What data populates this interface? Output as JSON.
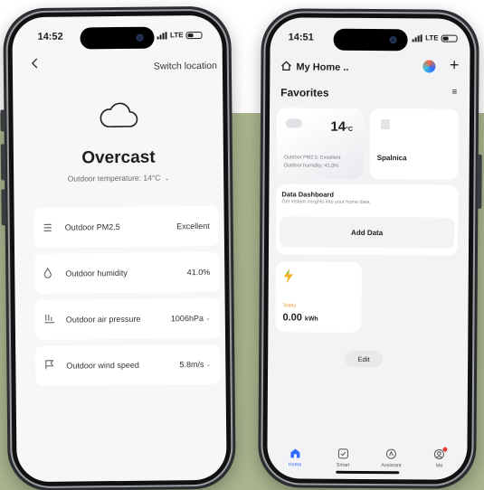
{
  "left_phone": {
    "status": {
      "time": "14:52",
      "network": "LTE"
    },
    "header": {
      "back_icon": "chevron-left-icon",
      "switch_location_label": "Switch location"
    },
    "weather": {
      "icon": "cloud-icon",
      "condition": "Overcast",
      "outdoor_temperature_label": "Outdoor temperature: 14°C",
      "temperature_chevron": "⌄"
    },
    "metrics": [
      {
        "icon": "pm25-icon",
        "glyph": "☰",
        "label": "Outdoor PM2.5",
        "value": "Excellent",
        "has_chevron": false
      },
      {
        "icon": "droplet-icon",
        "glyph": "◇",
        "label": "Outdoor humidity",
        "value": "41.0%",
        "has_chevron": false
      },
      {
        "icon": "pressure-icon",
        "glyph": "⫫",
        "label": "Outdoor air pressure",
        "value": "1006hPa",
        "has_chevron": true
      },
      {
        "icon": "wind-flag-icon",
        "glyph": "⚐",
        "label": "Outdoor wind speed",
        "value": "5.8m/s",
        "has_chevron": true
      }
    ],
    "chevron": "⌄"
  },
  "right_phone": {
    "status": {
      "time": "14:51",
      "network": "LTE"
    },
    "header": {
      "home_label": "My Home ..",
      "home_icon": "house-icon",
      "assistant_logo": "ai-assistant-logo-icon",
      "add_icon": "+"
    },
    "favorites": {
      "title": "Favorites",
      "list_icon": "≡"
    },
    "weather_card": {
      "temperature": "14",
      "unit": "°C",
      "pm25_line": "Outdoor PM2.5: Excellent",
      "humidity_line": "Outdoor humidity: 41.0%"
    },
    "device_card": {
      "name": "Spalnica",
      "icon": "speaker-icon"
    },
    "data_dashboard": {
      "title": "Data Dashboard",
      "subtitle": "Get instant insights into your home data.",
      "add_label": "Add Data"
    },
    "energy_card": {
      "icon": "lightning-icon",
      "period": "Today",
      "value": "0.00",
      "unit": "kWh"
    },
    "edit_label": "Edit",
    "tabs": [
      {
        "label": "Home",
        "icon": "home-tab-icon",
        "glyph": "⌂",
        "active": true,
        "badge": false
      },
      {
        "label": "Smart",
        "icon": "smart-checkbox-icon",
        "glyph": "☑",
        "active": false,
        "badge": false
      },
      {
        "label": "Assistant",
        "icon": "assistant-icon",
        "glyph": "⌾",
        "active": false,
        "badge": false
      },
      {
        "label": "Me",
        "icon": "profile-icon",
        "glyph": "☺",
        "active": false,
        "badge": true
      }
    ]
  },
  "colors": {
    "background_panel": "#a8b58e",
    "accent": "#2f6bff",
    "energy_accent": "#f0962b",
    "bolt": "#f2b31b",
    "notification": "#e53935"
  }
}
